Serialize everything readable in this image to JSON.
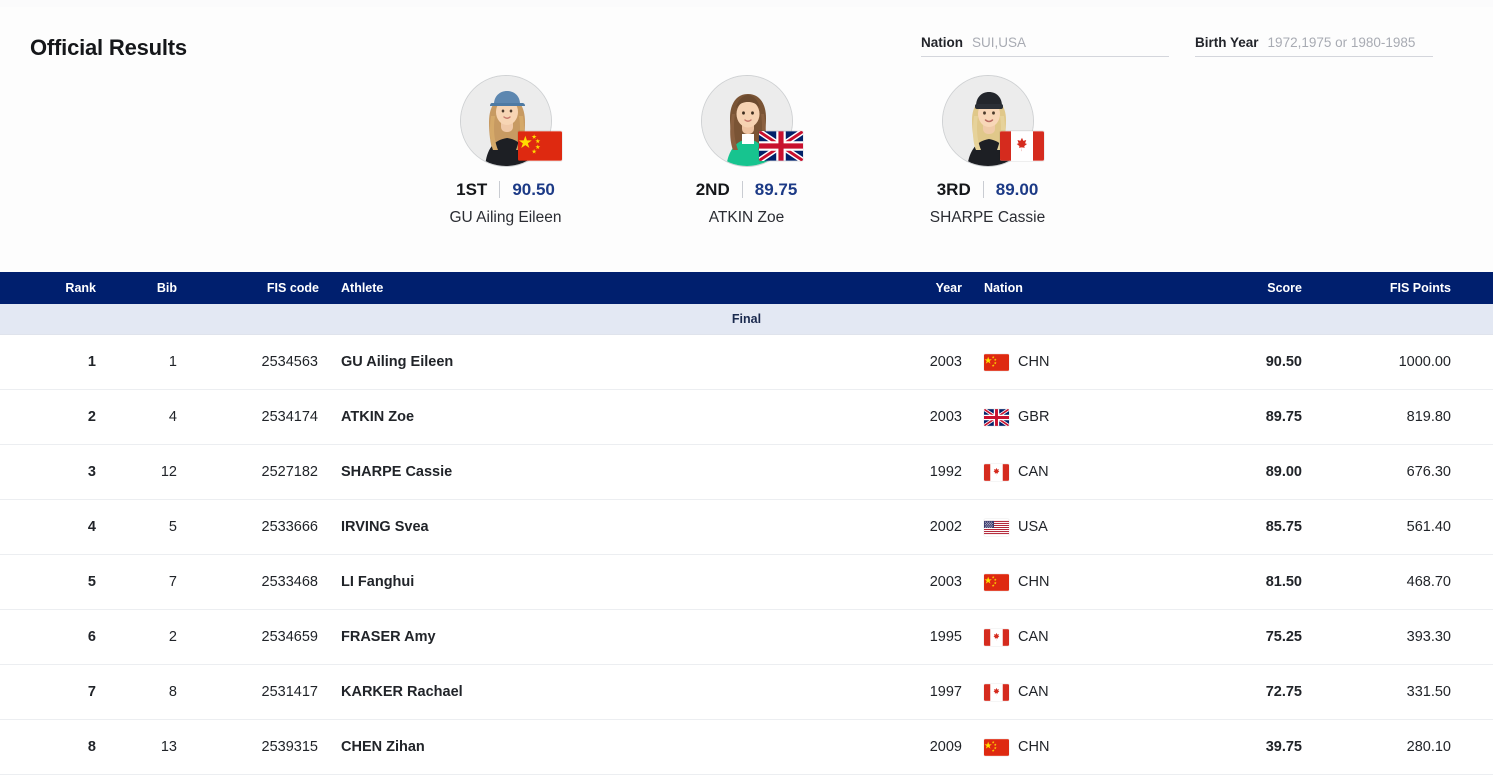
{
  "header": {
    "title": "Official Results",
    "filters": [
      {
        "name": "nation",
        "label": "Nation",
        "value": "",
        "placeholder": "SUI,USA"
      },
      {
        "name": "birth-year",
        "label": "Birth Year",
        "value": "",
        "placeholder": "1972,1975 or 1980-1985"
      }
    ]
  },
  "podium": [
    {
      "rank": "1ST",
      "score": "90.50",
      "name": "GU Ailing Eileen",
      "nation": "CHN"
    },
    {
      "rank": "2ND",
      "score": "89.75",
      "name": "ATKIN Zoe",
      "nation": "GBR"
    },
    {
      "rank": "3RD",
      "score": "89.00",
      "name": "SHARPE Cassie",
      "nation": "CAN"
    }
  ],
  "table": {
    "columns": {
      "rank": "Rank",
      "bib": "Bib",
      "fis_code": "FIS code",
      "athlete": "Athlete",
      "year": "Year",
      "nation": "Nation",
      "score": "Score",
      "fis_points": "FIS Points"
    },
    "section_label": "Final",
    "rows": [
      {
        "rank": "1",
        "bib": "1",
        "fis_code": "2534563",
        "athlete": "GU Ailing Eileen",
        "year": "2003",
        "nation": "CHN",
        "score": "90.50",
        "fis_points": "1000.00"
      },
      {
        "rank": "2",
        "bib": "4",
        "fis_code": "2534174",
        "athlete": "ATKIN Zoe",
        "year": "2003",
        "nation": "GBR",
        "score": "89.75",
        "fis_points": "819.80"
      },
      {
        "rank": "3",
        "bib": "12",
        "fis_code": "2527182",
        "athlete": "SHARPE Cassie",
        "year": "1992",
        "nation": "CAN",
        "score": "89.00",
        "fis_points": "676.30"
      },
      {
        "rank": "4",
        "bib": "5",
        "fis_code": "2533666",
        "athlete": "IRVING Svea",
        "year": "2002",
        "nation": "USA",
        "score": "85.75",
        "fis_points": "561.40"
      },
      {
        "rank": "5",
        "bib": "7",
        "fis_code": "2533468",
        "athlete": "LI Fanghui",
        "year": "2003",
        "nation": "CHN",
        "score": "81.50",
        "fis_points": "468.70"
      },
      {
        "rank": "6",
        "bib": "2",
        "fis_code": "2534659",
        "athlete": "FRASER Amy",
        "year": "1995",
        "nation": "CAN",
        "score": "75.25",
        "fis_points": "393.30"
      },
      {
        "rank": "7",
        "bib": "8",
        "fis_code": "2531417",
        "athlete": "KARKER Rachael",
        "year": "1997",
        "nation": "CAN",
        "score": "72.75",
        "fis_points": "331.50"
      },
      {
        "rank": "8",
        "bib": "13",
        "fis_code": "2539315",
        "athlete": "CHEN Zihan",
        "year": "2009",
        "nation": "CHN",
        "score": "39.75",
        "fis_points": "280.10"
      }
    ]
  },
  "colors": {
    "header_bar": "#001f6e",
    "section_band": "#e3e8f3",
    "score_blue": "#1c3a86",
    "page_bg": "#f1f3f7",
    "card_bg": "#fdfdfd"
  }
}
